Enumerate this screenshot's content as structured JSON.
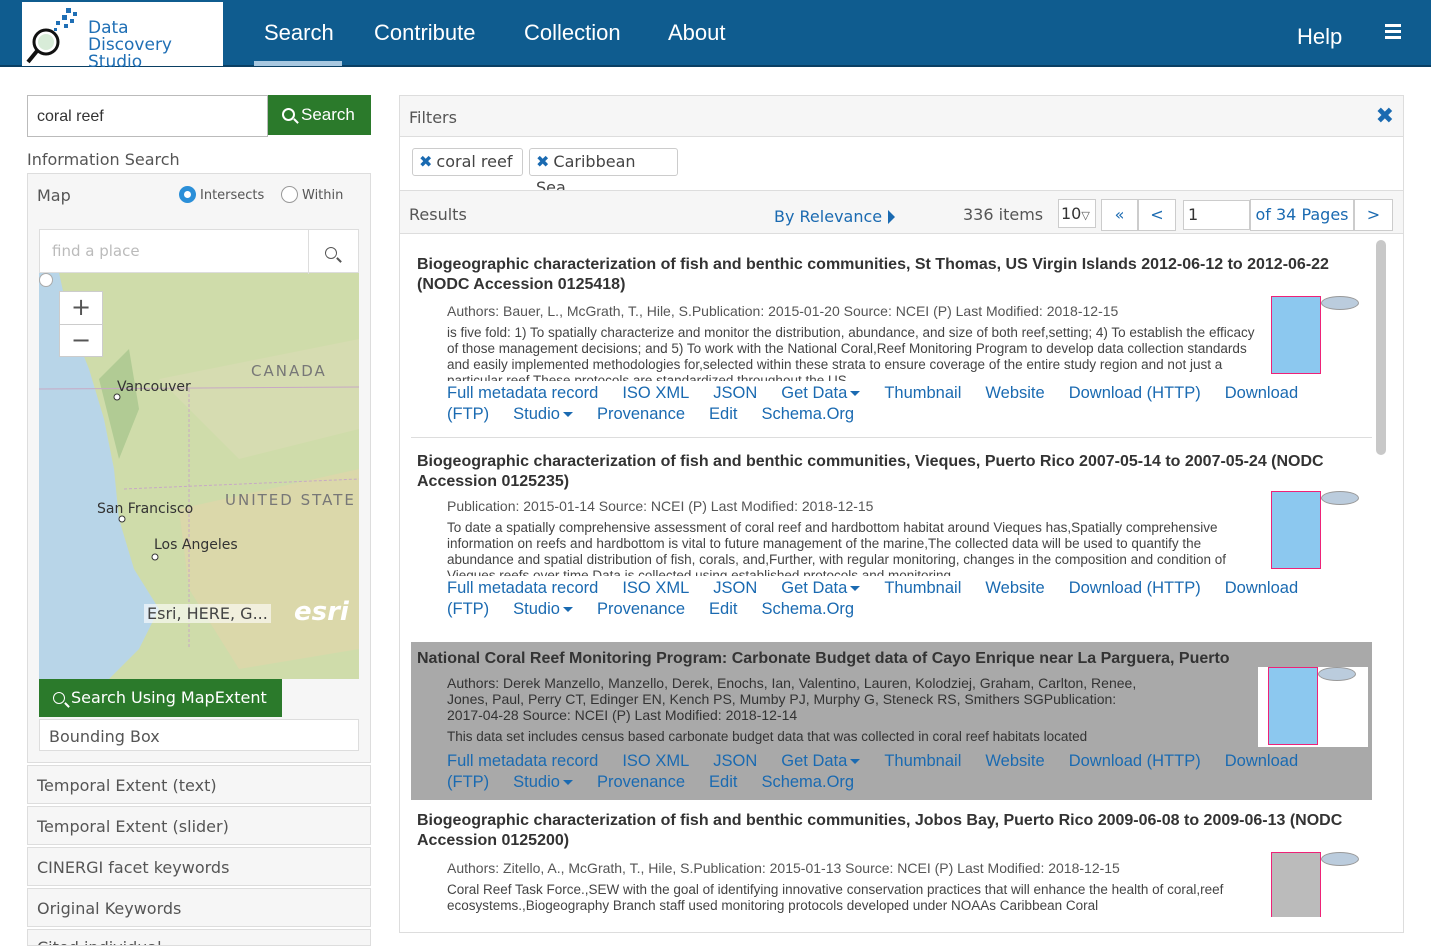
{
  "app": {
    "logo_line1": "Data",
    "logo_line2": "Discovery Studio"
  },
  "nav": {
    "search": "Search",
    "contribute": "Contribute",
    "collection": "Collection",
    "about": "About",
    "help": "Help"
  },
  "search": {
    "value": "coral reef",
    "button": "Search"
  },
  "sidebar": {
    "info_search": "Information Search",
    "map_label": "Map",
    "radio_intersects": "Intersects",
    "radio_within": "Within",
    "find_placeholder": "find  a place",
    "map_labels": {
      "canada": "CANADA",
      "vancouver": "Vancouver",
      "sf": "San Francisco",
      "la": "Los Angeles",
      "us": "UNITED  STATE"
    },
    "attribution": "Esri, HERE, G...",
    "esri": "esri",
    "mapextent_button": "Search Using MapExtent",
    "bounding_box": "Bounding Box",
    "facets": [
      "Temporal Extent (text)",
      "Temporal Extent (slider)",
      "CINERGI facet keywords",
      "Original Keywords",
      "Cited individual"
    ]
  },
  "filters": {
    "title": "Filters",
    "chips": [
      "coral reef",
      "Caribbean Sea"
    ]
  },
  "results_bar": {
    "label": "Results",
    "sort": "By Relevance",
    "count": "336 items",
    "per_page": "10",
    "first": "«",
    "prev": "<",
    "page": "1",
    "of_pages": "of 34 Pages",
    "next": ">"
  },
  "links": {
    "full": "Full metadata record",
    "iso": "ISO XML",
    "json": "JSON",
    "getdata": "Get Data",
    "thumbnail": "Thumbnail",
    "website": "Website",
    "dl_http": "Download (HTTP)",
    "download": "Download",
    "ftp": "(FTP)",
    "studio": "Studio",
    "provenance": "Provenance",
    "edit": "Edit",
    "schema": "Schema.Org"
  },
  "results": [
    {
      "title": "Biogeographic characterization of fish and benthic communities, St Thomas, US Virgin Islands 2012-06-12 to 2012-06-22 (NODC Accession 0125418)",
      "meta": "Authors: Bauer, L., McGrath, T., Hile, S.Publication: 2015-01-20 Source: NCEI (P) Last Modified: 2018-12-15",
      "abstract": "is five fold: 1) To spatially characterize and monitor the distribution, abundance, and size of both reef,setting; 4) To establish the efficacy of those management decisions; and 5) To work with the National Coral,Reef Monitoring Program to develop data collection standards and easily implemented methodologies for,selected within these strata to ensure coverage of the entire study region and not just a particular reef These protocols are standardized throughout the US"
    },
    {
      "title": "Biogeographic characterization of fish and benthic communities, Vieques, Puerto Rico 2007-05-14 to 2007-05-24 (NODC Accession 0125235)",
      "meta": "Publication: 2015-01-14 Source: NCEI (P) Last Modified: 2018-12-15",
      "abstract": "To date a spatially comprehensive assessment of coral reef and hardbottom habitat around Vieques has,Spatially comprehensive information on reefs and hardbottom is vital to future management of the marine,The collected data will be used to quantify the abundance and spatial distribution of fish, corals, and,Further, with regular monitoring, changes in the composition and condition of Vieques reefs over time Data is collected using established protocols and monitoring"
    },
    {
      "title": "National Coral Reef Monitoring Program: Carbonate Budget data of Cayo Enrique near La Parguera, Puerto",
      "meta": "Authors: Derek Manzello, Manzello, Derek, Enochs, Ian, Valentino, Lauren, Kolodziej, Graham, Carlton, Renee, Jones, Paul, Perry CT, Edinger EN, Kench PS, Mumby PJ, Murphy G, Steneck RS, Smithers SGPublication: 2017-04-28 Source: NCEI (P) Last Modified: 2018-12-14",
      "abstract": "This data set includes census based carbonate budget data that was collected in coral reef habitats located"
    },
    {
      "title": "Biogeographic characterization of fish and benthic communities, Jobos Bay, Puerto Rico 2009-06-08 to 2009-06-13 (NODC Accession 0125200)",
      "meta": "Authors: Zitello, A., McGrath, T., Hile, S.Publication: 2015-01-13 Source: NCEI (P) Last Modified: 2018-12-15",
      "abstract": "Coral Reef Task Force.,SEW with the goal of identifying innovative conservation practices that will enhance the health of coral,reef ecosystems.,Biogeography Branch staff used monitoring protocols developed under NOAAs Caribbean Coral"
    }
  ]
}
